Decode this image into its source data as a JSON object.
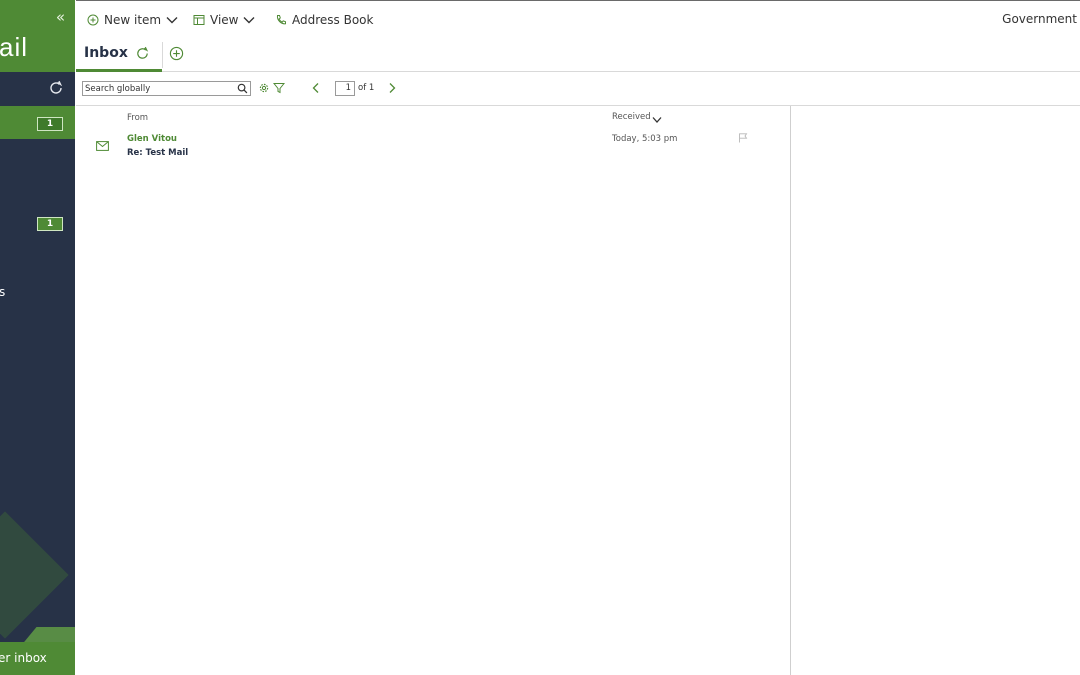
{
  "sidebar": {
    "collapse_glyph": "«",
    "logo_text": "ail",
    "inbox_badge": "1",
    "folder_badge": "1",
    "partial_label": "s",
    "bottom_link": "er inbox",
    "icons": {
      "collapse": "double-chevron-left-icon",
      "refresh": "refresh-icon"
    }
  },
  "toolbar": {
    "new_item_label": "New item",
    "view_label": "View",
    "address_book_label": "Address Book",
    "right_label": "Government"
  },
  "tabs": {
    "inbox_label": "Inbox"
  },
  "search": {
    "placeholder": "Search globally",
    "page_value": "1",
    "page_of": "of 1"
  },
  "list": {
    "columns": {
      "from": "From",
      "received": "Received"
    },
    "messages": [
      {
        "from": "Glen Vitou",
        "subject": "Re: Test Mail",
        "received": "Today, 5:03 pm"
      }
    ]
  },
  "colors": {
    "accent_green": "#4f8a35",
    "sidebar_dark": "#273247",
    "text_dark": "#273247"
  }
}
